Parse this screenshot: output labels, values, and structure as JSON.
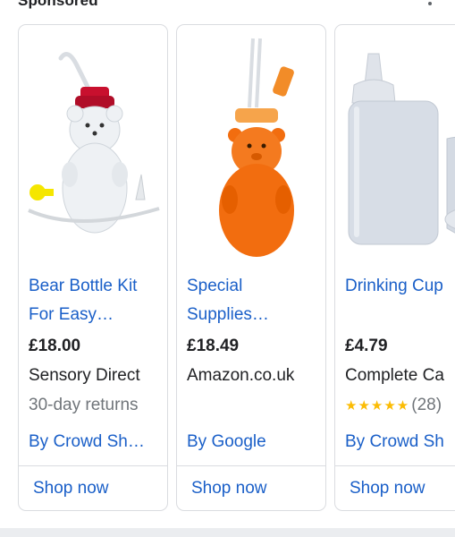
{
  "header": {
    "sponsored_label": "Sponsored"
  },
  "cards": [
    {
      "title": "Bear Bottle Kit\nFor Easy…",
      "price": "£18.00",
      "seller": "Sensory Direct",
      "note": "30-day returns",
      "byline": "By Crowd Sh…",
      "cta": "Shop now",
      "image_icon": "bear-bottle-kit-icon"
    },
    {
      "title": "Special\nSupplies…",
      "price": "£18.49",
      "seller": "Amazon.co.uk",
      "byline": "By Google",
      "cta": "Shop now",
      "image_icon": "orange-bear-bottle-icon"
    },
    {
      "title": "Drinking Cup",
      "price": "£4.79",
      "seller": "Complete Ca",
      "rating": 4.5,
      "rating_stars": "★★★★★",
      "rating_count": "(28)",
      "byline": "By Crowd Sh",
      "cta": "Shop now",
      "image_icon": "drinking-cup-icon"
    }
  ],
  "colors": {
    "link": "#1a5fc8",
    "star": "#fbbc04",
    "muted": "#70757a",
    "border": "#dadce0"
  }
}
